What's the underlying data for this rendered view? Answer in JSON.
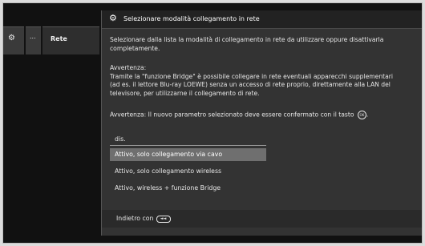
{
  "nav": {
    "gear_icon": "gear-icon",
    "dots_label": "...",
    "rete_label": "Rete"
  },
  "header": {
    "icon": "gear-icon",
    "title": "Selezionare modalità collegamento in rete"
  },
  "body": {
    "intro": "Selezionare dalla lista la modalità di collegamento in rete da utilizzare oppure disattivarla\ncompletamente.",
    "warning": "Avvertenza:\nTramite la \"funzione Bridge\" è possibile collegare in rete eventuali apparecchi supplementari\n(ad es. il lettore Blu-ray LOEWE) senza un accesso di rete proprio, direttamente alla LAN del\ntelevisore, per utilizzarne il collegamento di rete.",
    "confirm": "Avvertenza: Il nuovo parametro selezionato deve essere confermato con il tasto",
    "confirm_end": ".",
    "ok_key": "OK"
  },
  "options": [
    {
      "label": "dis.",
      "selected": false
    },
    {
      "label": "Attivo, solo collegamento via cavo",
      "selected": true
    },
    {
      "label": "Attivo, solo collegamento wireless",
      "selected": false
    },
    {
      "label": "Attivo, wireless + funzione Bridge",
      "selected": false
    }
  ],
  "footer": {
    "back_label": "Indietro con",
    "back_key": "◄◄"
  },
  "colors": {
    "panel_bg": "#333333",
    "selected_bg": "#6f6f6f",
    "screen_bg": "#111111"
  }
}
